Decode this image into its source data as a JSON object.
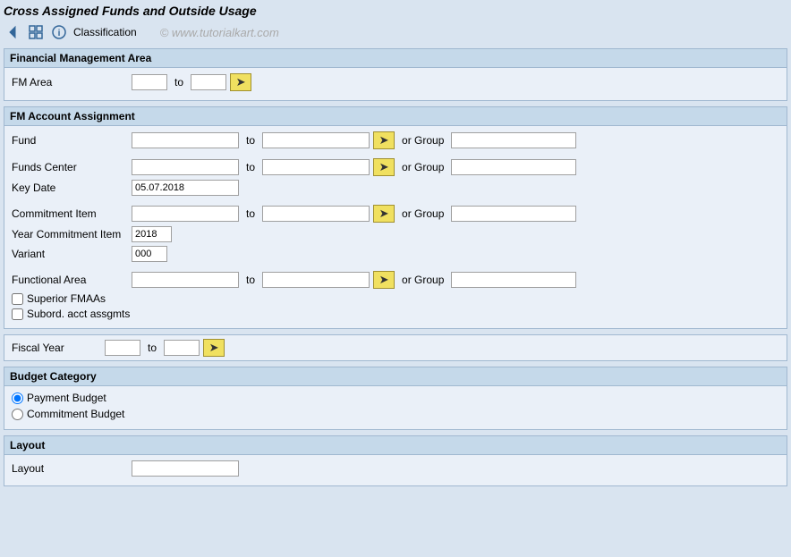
{
  "page": {
    "title": "Cross Assigned Funds and Outside Usage",
    "watermark": "© www.tutorialkart.com"
  },
  "toolbar": {
    "back_icon": "◄",
    "grid_icon": "▦",
    "info_icon": "ℹ",
    "classification_label": "Classification"
  },
  "sections": {
    "financial_management_area": {
      "header": "Financial Management Area",
      "fm_area_label": "FM Area",
      "to_label": "to",
      "fm_area_from": "",
      "fm_area_to": ""
    },
    "fm_account_assignment": {
      "header": "FM Account Assignment",
      "fund_label": "Fund",
      "fund_from": "",
      "fund_to": "",
      "fund_to_label": "to",
      "or_group_label": "or Group",
      "fund_group": "",
      "funds_center_label": "Funds Center",
      "funds_center_from": "",
      "funds_center_to": "",
      "funds_center_group": "",
      "key_date_label": "Key Date",
      "key_date_value": "05.07.2018",
      "commitment_item_label": "Commitment Item",
      "commitment_item_from": "",
      "commitment_item_to": "",
      "commitment_item_group": "",
      "year_commitment_item_label": "Year Commitment Item",
      "year_commitment_item_value": "2018",
      "variant_label": "Variant",
      "variant_value": "000",
      "functional_area_label": "Functional Area",
      "functional_area_from": "",
      "functional_area_to": "",
      "functional_area_group": "",
      "superior_fmaas_label": "Superior FMAAs",
      "subord_acct_assgmts_label": "Subord. acct assgmts"
    },
    "fiscal_year": {
      "label": "Fiscal Year",
      "from": "",
      "to": "",
      "to_label": "to"
    },
    "budget_category": {
      "header": "Budget Category",
      "payment_budget_label": "Payment Budget",
      "commitment_budget_label": "Commitment Budget",
      "payment_budget_selected": true
    },
    "layout": {
      "header": "Layout",
      "layout_label": "Layout",
      "layout_value": ""
    }
  },
  "arrow": "➔"
}
